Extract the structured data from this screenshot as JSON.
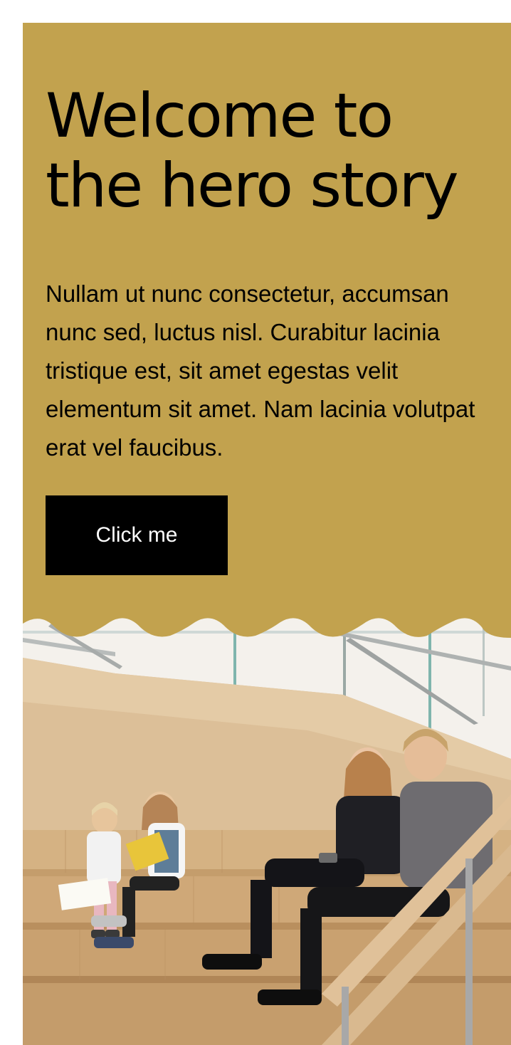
{
  "hero": {
    "title": "Welcome to the hero story",
    "text": "Nullam ut nunc consectetur, accumsan nunc sed, luctus nisl. Curabitur lacinia tristique est, sit amet egestas velit elementum sit amet. Nam lacinia volutpat erat vel faucibus.",
    "button_label": "Click me"
  },
  "colors": {
    "hero_background": "#c2a24e",
    "button_background": "#000000",
    "button_text": "#ffffff"
  },
  "image": {
    "description_icon": "photo-library-stairs"
  }
}
